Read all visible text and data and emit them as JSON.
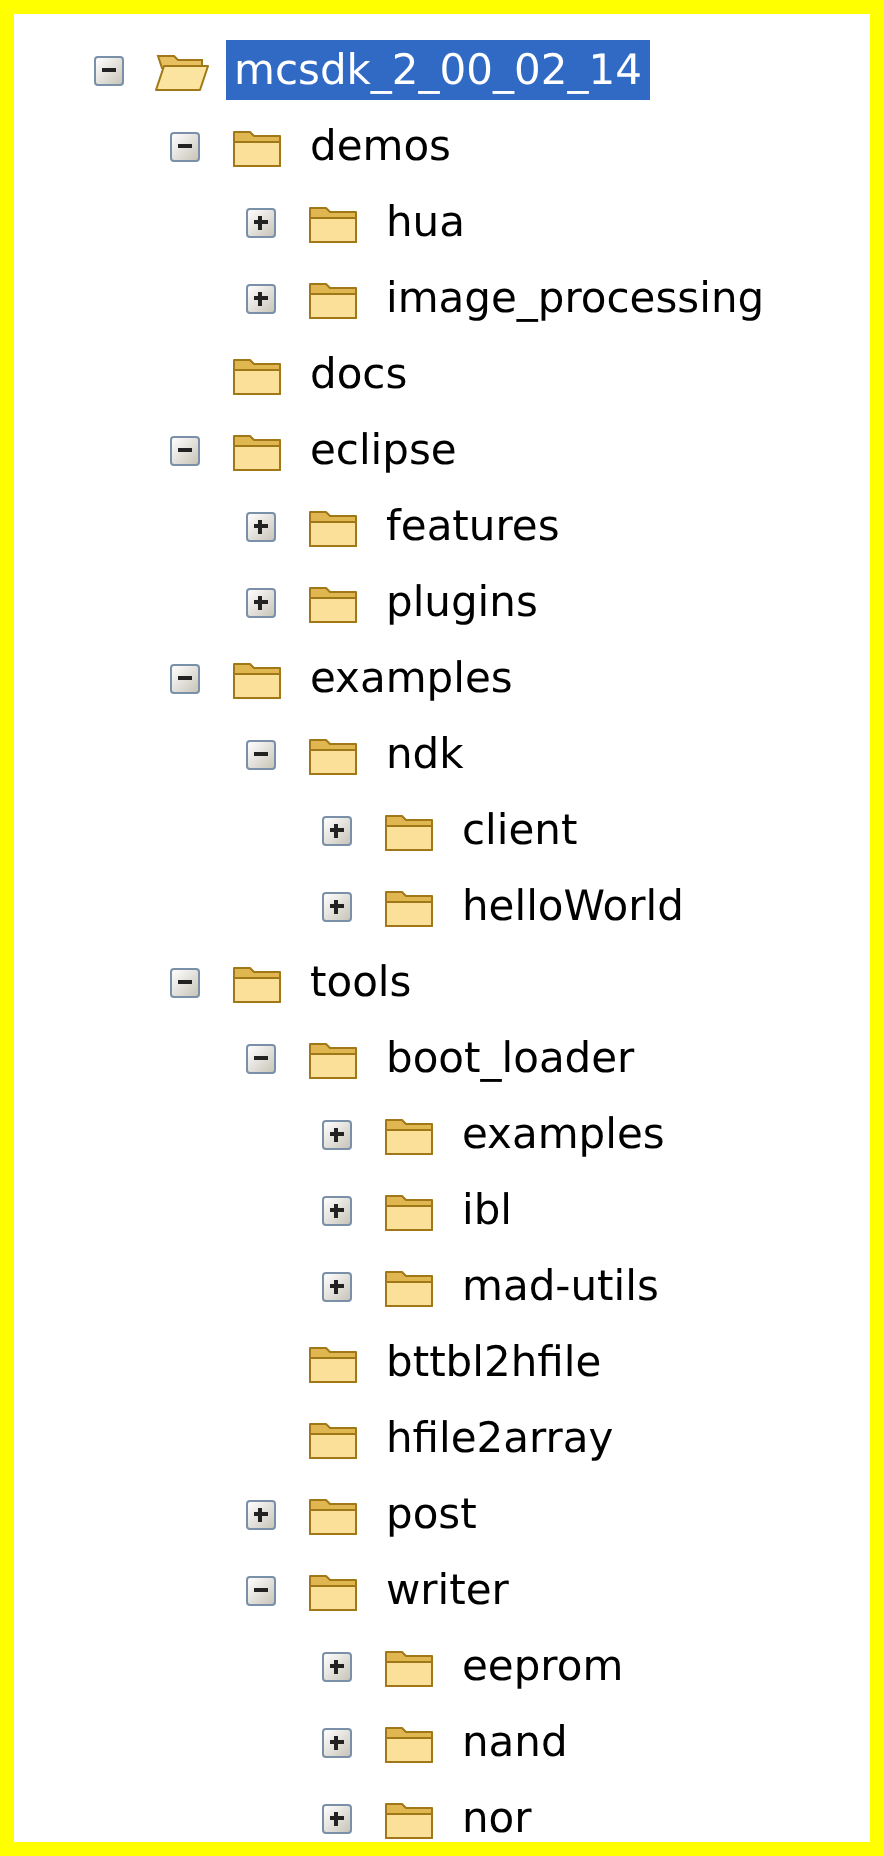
{
  "tree": [
    {
      "label": "mcsdk_2_00_02_14",
      "selected": true,
      "kind": "branch",
      "expanded": true,
      "children": [
        {
          "label": "demos",
          "selected": false,
          "kind": "branch",
          "expanded": true,
          "children": [
            {
              "label": "hua",
              "selected": false,
              "kind": "branch",
              "expanded": false
            },
            {
              "label": "image_processing",
              "selected": false,
              "kind": "branch",
              "expanded": false
            }
          ]
        },
        {
          "label": "docs",
          "selected": false,
          "kind": "leaf"
        },
        {
          "label": "eclipse",
          "selected": false,
          "kind": "branch",
          "expanded": true,
          "children": [
            {
              "label": "features",
              "selected": false,
              "kind": "branch",
              "expanded": false
            },
            {
              "label": "plugins",
              "selected": false,
              "kind": "branch",
              "expanded": false
            }
          ]
        },
        {
          "label": "examples",
          "selected": false,
          "kind": "branch",
          "expanded": true,
          "children": [
            {
              "label": "ndk",
              "selected": false,
              "kind": "branch",
              "expanded": true,
              "children": [
                {
                  "label": "client",
                  "selected": false,
                  "kind": "branch",
                  "expanded": false
                },
                {
                  "label": "helloWorld",
                  "selected": false,
                  "kind": "branch",
                  "expanded": false
                }
              ]
            }
          ]
        },
        {
          "label": "tools",
          "selected": false,
          "kind": "branch",
          "expanded": true,
          "children": [
            {
              "label": "boot_loader",
              "selected": false,
              "kind": "branch",
              "expanded": true,
              "children": [
                {
                  "label": "examples",
                  "selected": false,
                  "kind": "branch",
                  "expanded": false
                },
                {
                  "label": "ibl",
                  "selected": false,
                  "kind": "branch",
                  "expanded": false
                },
                {
                  "label": "mad-utils",
                  "selected": false,
                  "kind": "branch",
                  "expanded": false
                }
              ]
            },
            {
              "label": "bttbl2hfile",
              "selected": false,
              "kind": "leaf"
            },
            {
              "label": "hfile2array",
              "selected": false,
              "kind": "leaf"
            },
            {
              "label": "post",
              "selected": false,
              "kind": "branch",
              "expanded": false
            },
            {
              "label": "writer",
              "selected": false,
              "kind": "branch",
              "expanded": true,
              "children": [
                {
                  "label": "eeprom",
                  "selected": false,
                  "kind": "branch",
                  "expanded": false
                },
                {
                  "label": "nand",
                  "selected": false,
                  "kind": "branch",
                  "expanded": false
                },
                {
                  "label": "nor",
                  "selected": false,
                  "kind": "branch",
                  "expanded": false
                }
              ]
            }
          ]
        }
      ]
    }
  ]
}
